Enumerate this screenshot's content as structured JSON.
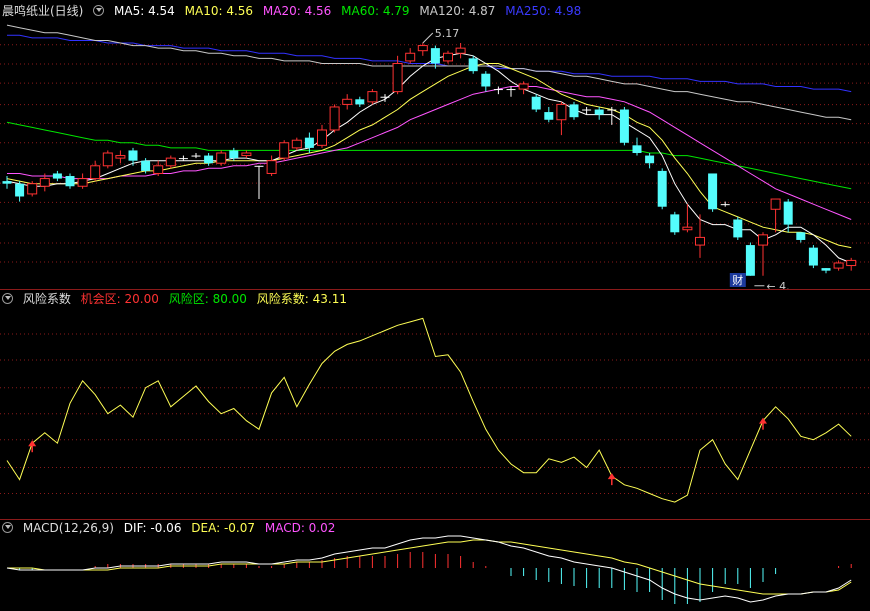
{
  "colors": {
    "up": "#ff3232",
    "down": "#54fcfc",
    "doji": "#ffffff",
    "ma5": "#ffffff",
    "ma10": "#ffff55",
    "ma20": "#ff55ff",
    "ma60": "#00e600",
    "ma120": "#c8c8c8",
    "ma250": "#3232ff",
    "risk": "#ffff55",
    "chance": "#ff3232",
    "riskzone": "#00e600",
    "grid": "#8b1a1a",
    "divider": "#8b1a1a"
  },
  "header_main": {
    "stock": "晨鸣纸业(日线)",
    "ma5": "MA5: 4.54",
    "ma10": "MA10: 4.56",
    "ma20": "MA20: 4.56",
    "ma60": "MA60: 4.79",
    "ma120": "MA120: 4.87",
    "ma250": "MA250: 4.98"
  },
  "header_risk": {
    "name": "风险系数",
    "chance": "机会区: 20.00",
    "riskzone": "风险区: 80.00",
    "value": "风险系数: 43.11"
  },
  "header_macd": {
    "name": "MACD(12,26,9)",
    "dif": "DIF: -0.06",
    "dea": "DEA: -0.07",
    "macd": "MACD: 0.02"
  },
  "annotations": {
    "high": "5.17",
    "low": "4.",
    "event": "财"
  },
  "chart_data": [
    {
      "type": "candlestick",
      "title": "晨鸣纸业(日线)",
      "candles": [
        [
          4.63,
          4.62,
          4.65,
          4.6
        ],
        [
          4.62,
          4.57,
          4.63,
          4.55
        ],
        [
          4.58,
          4.62,
          4.63,
          4.57
        ],
        [
          4.61,
          4.64,
          4.66,
          4.59
        ],
        [
          4.66,
          4.64,
          4.67,
          4.63
        ],
        [
          4.65,
          4.61,
          4.66,
          4.6
        ],
        [
          4.61,
          4.64,
          4.66,
          4.6
        ],
        [
          4.64,
          4.69,
          4.71,
          4.63
        ],
        [
          4.69,
          4.74,
          4.75,
          4.68
        ],
        [
          4.72,
          4.73,
          4.75,
          4.7
        ],
        [
          4.75,
          4.71,
          4.76,
          4.69
        ],
        [
          4.71,
          4.67,
          4.72,
          4.66
        ],
        [
          4.66,
          4.69,
          4.71,
          4.65
        ],
        [
          4.69,
          4.72,
          4.73,
          4.68
        ],
        [
          4.72,
          4.72,
          4.73,
          4.71
        ],
        [
          4.73,
          4.73,
          4.74,
          4.72
        ],
        [
          4.73,
          4.7,
          4.74,
          4.69
        ],
        [
          4.7,
          4.74,
          4.75,
          4.69
        ],
        [
          4.75,
          4.72,
          4.76,
          4.71
        ],
        [
          4.73,
          4.74,
          4.75,
          4.72
        ],
        [
          4.69,
          4.69,
          4.69,
          4.56
        ],
        [
          4.66,
          4.71,
          4.73,
          4.65
        ],
        [
          4.72,
          4.78,
          4.79,
          4.71
        ],
        [
          4.76,
          4.79,
          4.8,
          4.75
        ],
        [
          4.8,
          4.76,
          4.82,
          4.74
        ],
        [
          4.77,
          4.83,
          4.85,
          4.76
        ],
        [
          4.83,
          4.92,
          4.93,
          4.82
        ],
        [
          4.93,
          4.95,
          4.97,
          4.91
        ],
        [
          4.95,
          4.93,
          4.96,
          4.92
        ],
        [
          4.94,
          4.98,
          4.99,
          4.93
        ],
        [
          4.96,
          4.96,
          4.97,
          4.94
        ],
        [
          4.98,
          5.09,
          5.12,
          4.97
        ],
        [
          5.1,
          5.13,
          5.15,
          5.09
        ],
        [
          5.14,
          5.16,
          5.17,
          5.12
        ],
        [
          5.15,
          5.09,
          5.16,
          5.07
        ],
        [
          5.1,
          5.13,
          5.14,
          5.09
        ],
        [
          5.13,
          5.15,
          5.17,
          5.11
        ],
        [
          5.11,
          5.06,
          5.12,
          5.05
        ],
        [
          5.05,
          5.0,
          5.06,
          4.98
        ],
        [
          4.99,
          4.99,
          5.0,
          4.97
        ],
        [
          4.99,
          4.99,
          5.0,
          4.96
        ],
        [
          4.99,
          5.01,
          5.02,
          4.97
        ],
        [
          4.96,
          4.91,
          4.97,
          4.9
        ],
        [
          4.9,
          4.87,
          4.92,
          4.86
        ],
        [
          4.87,
          4.93,
          4.94,
          4.81
        ],
        [
          4.93,
          4.88,
          4.94,
          4.87
        ],
        [
          4.91,
          4.91,
          4.92,
          4.89
        ],
        [
          4.91,
          4.89,
          4.92,
          4.87
        ],
        [
          4.91,
          4.91,
          4.92,
          4.85
        ],
        [
          4.91,
          4.78,
          4.92,
          4.77
        ],
        [
          4.77,
          4.74,
          4.8,
          4.73
        ],
        [
          4.73,
          4.7,
          4.74,
          4.68
        ],
        [
          4.67,
          4.53,
          4.68,
          4.52
        ],
        [
          4.5,
          4.43,
          4.51,
          4.42
        ],
        [
          4.44,
          4.45,
          4.54,
          4.43
        ],
        [
          4.38,
          4.41,
          4.5,
          4.33
        ],
        [
          4.66,
          4.52,
          4.62,
          4.51
        ],
        [
          4.54,
          4.54,
          4.55,
          4.53
        ],
        [
          4.48,
          4.41,
          4.49,
          4.4
        ],
        [
          4.38,
          4.26,
          4.39,
          4.26
        ],
        [
          4.38,
          4.42,
          4.43,
          4.26
        ],
        [
          4.52,
          4.56,
          4.56,
          4.43
        ],
        [
          4.55,
          4.46,
          4.56,
          4.43
        ],
        [
          4.43,
          4.4,
          4.43,
          4.39
        ],
        [
          4.37,
          4.3,
          4.38,
          4.29
        ],
        [
          4.29,
          4.28,
          4.29,
          4.27
        ],
        [
          4.29,
          4.31,
          4.32,
          4.28
        ],
        [
          4.3,
          4.32,
          4.33,
          4.28
        ]
      ],
      "ma5": [
        4.63,
        4.62,
        4.61,
        4.61,
        4.62,
        4.62,
        4.63,
        4.64,
        4.66,
        4.68,
        4.7,
        4.71,
        4.71,
        4.71,
        4.71,
        4.71,
        4.71,
        4.71,
        4.72,
        4.72,
        4.71,
        4.71,
        4.73,
        4.75,
        4.76,
        4.79,
        4.83,
        4.86,
        4.9,
        4.93,
        4.95,
        4.99,
        5.04,
        5.08,
        5.11,
        5.12,
        5.13,
        5.12,
        5.09,
        5.06,
        5.02,
        4.99,
        4.97,
        4.95,
        4.94,
        4.91,
        4.89,
        4.89,
        4.89,
        4.86,
        4.83,
        4.8,
        4.73,
        4.62,
        4.54,
        4.48,
        4.46,
        4.46,
        4.44,
        4.44,
        4.4,
        4.42,
        4.45,
        4.45,
        4.42,
        4.38,
        4.33,
        4.31
      ],
      "ma10": [
        4.64,
        4.63,
        4.62,
        4.62,
        4.62,
        4.62,
        4.62,
        4.63,
        4.64,
        4.65,
        4.66,
        4.67,
        4.67,
        4.68,
        4.69,
        4.7,
        4.7,
        4.71,
        4.71,
        4.71,
        4.71,
        4.71,
        4.72,
        4.73,
        4.74,
        4.75,
        4.77,
        4.8,
        4.83,
        4.85,
        4.88,
        4.91,
        4.95,
        4.98,
        5.01,
        5.04,
        5.06,
        5.08,
        5.09,
        5.09,
        5.07,
        5.05,
        5.03,
        5.0,
        4.97,
        4.95,
        4.93,
        4.92,
        4.91,
        4.89,
        4.86,
        4.84,
        4.79,
        4.72,
        4.66,
        4.59,
        4.53,
        4.51,
        4.49,
        4.47,
        4.45,
        4.44,
        4.43,
        4.43,
        4.42,
        4.4,
        4.38,
        4.37
      ],
      "ma20": [
        4.66,
        4.66,
        4.65,
        4.65,
        4.65,
        4.64,
        4.64,
        4.64,
        4.64,
        4.65,
        4.65,
        4.65,
        4.66,
        4.66,
        4.67,
        4.67,
        4.68,
        4.68,
        4.69,
        4.69,
        4.7,
        4.7,
        4.71,
        4.72,
        4.73,
        4.74,
        4.75,
        4.76,
        4.78,
        4.8,
        4.82,
        4.84,
        4.87,
        4.89,
        4.91,
        4.93,
        4.95,
        4.97,
        4.98,
        4.99,
        5.0,
        5.0,
        5.0,
        4.99,
        4.98,
        4.97,
        4.96,
        4.96,
        4.95,
        4.94,
        4.92,
        4.9,
        4.87,
        4.84,
        4.81,
        4.78,
        4.75,
        4.72,
        4.69,
        4.66,
        4.63,
        4.6,
        4.58,
        4.56,
        4.54,
        4.52,
        4.5,
        4.48
      ],
      "ma60": [
        4.86,
        4.85,
        4.84,
        4.83,
        4.82,
        4.81,
        4.8,
        4.79,
        4.79,
        4.78,
        4.78,
        4.77,
        4.77,
        4.76,
        4.76,
        4.76,
        4.75,
        4.75,
        4.75,
        4.75,
        4.75,
        4.75,
        4.75,
        4.75,
        4.75,
        4.75,
        4.75,
        4.75,
        4.75,
        4.75,
        4.75,
        4.75,
        4.75,
        4.75,
        4.75,
        4.75,
        4.75,
        4.75,
        4.75,
        4.75,
        4.75,
        4.75,
        4.75,
        4.75,
        4.75,
        4.75,
        4.75,
        4.75,
        4.75,
        4.75,
        4.75,
        4.74,
        4.74,
        4.73,
        4.73,
        4.72,
        4.71,
        4.7,
        4.69,
        4.68,
        4.67,
        4.66,
        4.65,
        4.64,
        4.63,
        4.62,
        4.61,
        4.6
      ],
      "ma120": [
        5.24,
        5.23,
        5.22,
        5.21,
        5.21,
        5.2,
        5.19,
        5.18,
        5.18,
        5.17,
        5.16,
        5.16,
        5.15,
        5.15,
        5.14,
        5.14,
        5.13,
        5.13,
        5.12,
        5.12,
        5.11,
        5.11,
        5.1,
        5.1,
        5.1,
        5.09,
        5.09,
        5.09,
        5.09,
        5.08,
        5.08,
        5.08,
        5.08,
        5.08,
        5.08,
        5.08,
        5.08,
        5.08,
        5.08,
        5.08,
        5.07,
        5.07,
        5.06,
        5.06,
        5.05,
        5.04,
        5.04,
        5.03,
        5.02,
        5.01,
        5.01,
        5.0,
        4.99,
        4.98,
        4.98,
        4.97,
        4.96,
        4.95,
        4.94,
        4.94,
        4.93,
        4.92,
        4.91,
        4.9,
        4.89,
        4.88,
        4.88,
        4.87
      ],
      "ma250": [
        5.2,
        5.2,
        5.19,
        5.19,
        5.19,
        5.18,
        5.18,
        5.18,
        5.17,
        5.17,
        5.17,
        5.16,
        5.16,
        5.16,
        5.15,
        5.15,
        5.15,
        5.14,
        5.14,
        5.14,
        5.13,
        5.13,
        5.13,
        5.12,
        5.12,
        5.12,
        5.11,
        5.11,
        5.11,
        5.1,
        5.1,
        5.1,
        5.09,
        5.09,
        5.09,
        5.08,
        5.08,
        5.08,
        5.08,
        5.07,
        5.07,
        5.07,
        5.06,
        5.06,
        5.06,
        5.05,
        5.05,
        5.05,
        5.04,
        5.04,
        5.04,
        5.04,
        5.03,
        5.03,
        5.03,
        5.02,
        5.02,
        5.02,
        5.01,
        5.01,
        5.01,
        5.0,
        5.0,
        5.0,
        4.99,
        4.99,
        4.99,
        4.98
      ],
      "ylim": [
        4.22,
        5.26
      ],
      "grid_levels": [
        5.163,
        5.088,
        5.013,
        4.929,
        4.855,
        4.78,
        4.696,
        4.622,
        4.547,
        4.463,
        4.388,
        4.314
      ]
    },
    {
      "type": "line",
      "title": "风险系数",
      "values": [
        52,
        41,
        62,
        68,
        62,
        85,
        98,
        90,
        79,
        84,
        77,
        94,
        98,
        83,
        89,
        95,
        86,
        79,
        82,
        75,
        70,
        91,
        100,
        83,
        96,
        108,
        115,
        119,
        121,
        124,
        127,
        130,
        132,
        134,
        112,
        113,
        103,
        86,
        70,
        58,
        50,
        45,
        45,
        53,
        51,
        54,
        48,
        58,
        43,
        38,
        36,
        33,
        30,
        28,
        32,
        58,
        64,
        50,
        41,
        58,
        75,
        83,
        76,
        66,
        64,
        68,
        73,
        66
      ],
      "zones": {
        "chance": 20,
        "risk": 80
      },
      "ylim": [
        20,
        140
      ],
      "grid_levels": [
        125,
        110,
        94,
        79,
        64,
        48,
        33
      ],
      "signals": [
        2,
        48,
        60
      ]
    },
    {
      "type": "bar+line",
      "title": "MACD(12,26,9)",
      "dif": [
        0.0,
        -0.01,
        -0.01,
        -0.01,
        -0.01,
        -0.01,
        -0.01,
        0.0,
        0.0,
        0.01,
        0.01,
        0.01,
        0.01,
        0.02,
        0.02,
        0.02,
        0.02,
        0.03,
        0.03,
        0.03,
        0.02,
        0.02,
        0.03,
        0.04,
        0.04,
        0.05,
        0.07,
        0.08,
        0.09,
        0.1,
        0.1,
        0.12,
        0.14,
        0.15,
        0.15,
        0.16,
        0.16,
        0.15,
        0.14,
        0.13,
        0.11,
        0.1,
        0.08,
        0.06,
        0.05,
        0.03,
        0.02,
        0.01,
        0.0,
        -0.02,
        -0.04,
        -0.06,
        -0.1,
        -0.13,
        -0.15,
        -0.16,
        -0.15,
        -0.14,
        -0.15,
        -0.17,
        -0.16,
        -0.14,
        -0.13,
        -0.13,
        -0.12,
        -0.12,
        -0.1,
        -0.06
      ],
      "dea": [
        0.0,
        0.0,
        0.0,
        -0.01,
        -0.01,
        -0.01,
        -0.01,
        -0.01,
        -0.01,
        0.0,
        0.0,
        0.0,
        0.0,
        0.01,
        0.01,
        0.01,
        0.01,
        0.02,
        0.02,
        0.02,
        0.02,
        0.02,
        0.02,
        0.03,
        0.03,
        0.03,
        0.04,
        0.05,
        0.06,
        0.07,
        0.08,
        0.09,
        0.1,
        0.11,
        0.12,
        0.13,
        0.13,
        0.14,
        0.14,
        0.13,
        0.13,
        0.12,
        0.11,
        0.1,
        0.09,
        0.08,
        0.07,
        0.06,
        0.05,
        0.03,
        0.02,
        0.0,
        -0.02,
        -0.04,
        -0.06,
        -0.08,
        -0.09,
        -0.1,
        -0.11,
        -0.12,
        -0.13,
        -0.13,
        -0.13,
        -0.13,
        -0.12,
        -0.12,
        -0.11,
        -0.07
      ],
      "macd": [
        0.0,
        -0.01,
        -0.01,
        0.0,
        0.0,
        0.0,
        0.0,
        0.01,
        0.02,
        0.02,
        0.02,
        0.02,
        0.02,
        0.02,
        0.02,
        0.02,
        0.02,
        0.02,
        0.02,
        0.02,
        0.01,
        0.01,
        0.02,
        0.03,
        0.03,
        0.04,
        0.05,
        0.06,
        0.06,
        0.06,
        0.06,
        0.07,
        0.08,
        0.08,
        0.07,
        0.07,
        0.06,
        0.03,
        0.01,
        0.0,
        -0.04,
        -0.04,
        -0.06,
        -0.07,
        -0.08,
        -0.09,
        -0.1,
        -0.1,
        -0.1,
        -0.11,
        -0.12,
        -0.12,
        -0.16,
        -0.18,
        -0.18,
        -0.17,
        -0.12,
        -0.08,
        -0.08,
        -0.1,
        -0.07,
        -0.03,
        0.0,
        0.0,
        0.0,
        0.0,
        0.01,
        0.02
      ],
      "ylim": [
        -0.21,
        0.2
      ]
    }
  ]
}
